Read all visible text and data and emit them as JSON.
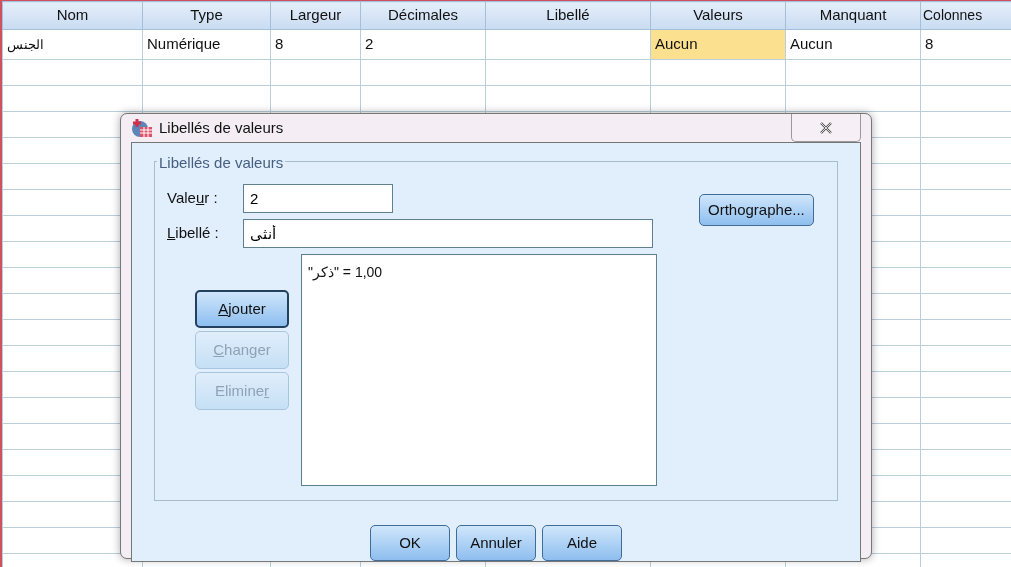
{
  "grid": {
    "columns": [
      "Nom",
      "Type",
      "Largeur",
      "Décimales",
      "Libellé",
      "Valeurs",
      "Manquant",
      "Colonnes"
    ],
    "rows": [
      {
        "cells": [
          {
            "text": "الجنس",
            "selected": false
          },
          {
            "text": "Numérique",
            "selected": false
          },
          {
            "text": "8",
            "selected": false
          },
          {
            "text": "2",
            "selected": false
          },
          {
            "text": "",
            "selected": false
          },
          {
            "text": "Aucun",
            "selected": true
          },
          {
            "text": "Aucun",
            "selected": false
          },
          {
            "text": "8",
            "selected": false
          }
        ]
      }
    ]
  },
  "dialog": {
    "title": "Libellés de valeurs",
    "group_title": "Libellés de valeurs",
    "fields": [
      {
        "label": {
          "pre": "Vale",
          "key": "u",
          "post": "r :"
        },
        "value": "2"
      },
      {
        "label": {
          "key": "L",
          "post": "ibellé :"
        },
        "value": "أنثى"
      }
    ],
    "spelling_button": "Orthographe...",
    "side_buttons": [
      {
        "label": {
          "key": "A",
          "post": "jouter"
        },
        "disabled": false,
        "focused": true
      },
      {
        "label": {
          "key": "C",
          "post": "hanger"
        },
        "disabled": true,
        "focused": false
      },
      {
        "label": {
          "pre": "Elimine",
          "key": "r"
        },
        "disabled": true,
        "focused": false
      }
    ],
    "list_items": [
      "1,00 = \"ذكر\""
    ],
    "buttons": [
      "OK",
      "Annuler",
      "Aide"
    ]
  }
}
